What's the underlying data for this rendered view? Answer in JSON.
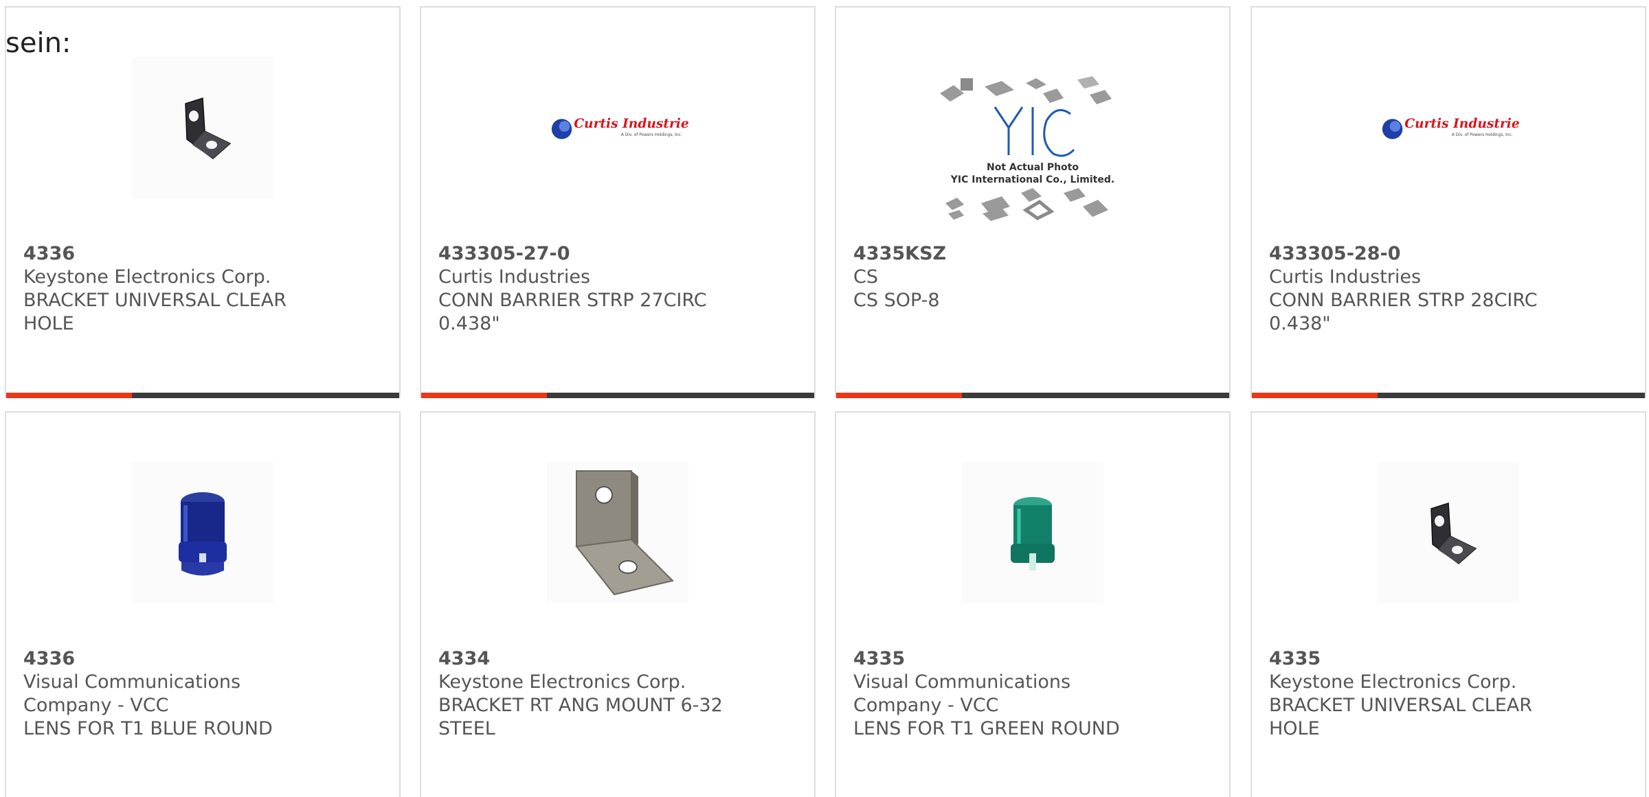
{
  "intro_text": "sein:",
  "colors": {
    "accent": "#e8391a",
    "bar": "#3b3b3b",
    "text": "#555555",
    "border": "#dedede"
  },
  "products": [
    {
      "part_number": "4336",
      "manufacturer": "Keystone Electronics Corp.",
      "description": "BRACKET UNIVERSAL CLEAR HOLE",
      "image": "bracket-small-icon"
    },
    {
      "part_number": "433305-27-0",
      "manufacturer": "Curtis Industries",
      "description": "CONN BARRIER STRP 27CIRC 0.438\"",
      "image": "curtis-industries-logo",
      "logo_text": "Curtis Industries",
      "logo_subtext": "A Div. of Powers Holdings, Inc."
    },
    {
      "part_number": "4335KSZ",
      "manufacturer": "CS",
      "description": "CS SOP-8",
      "image": "yic-placeholder-image",
      "placeholder_line1": "Not Actual Photo",
      "placeholder_line2": "YIC International Co., Limited."
    },
    {
      "part_number": "433305-28-0",
      "manufacturer": "Curtis Industries",
      "description": "CONN BARRIER STRP 28CIRC 0.438\"",
      "image": "curtis-industries-logo",
      "logo_text": "Curtis Industries",
      "logo_subtext": "A Div. of Powers Holdings, Inc."
    },
    {
      "part_number": "4336",
      "manufacturer": "Visual Communications Company - VCC",
      "description": "LENS FOR T1 BLUE ROUND",
      "image": "blue-lens-icon"
    },
    {
      "part_number": "4334",
      "manufacturer": "Keystone Electronics Corp.",
      "description": "BRACKET RT ANG MOUNT 6-32 STEEL",
      "image": "steel-bracket-icon"
    },
    {
      "part_number": "4335",
      "manufacturer": "Visual Communications Company - VCC",
      "description": "LENS FOR T1 GREEN ROUND",
      "image": "green-lens-icon"
    },
    {
      "part_number": "4335",
      "manufacturer": "Keystone Electronics Corp.",
      "description": "BRACKET UNIVERSAL CLEAR HOLE",
      "image": "bracket-small-icon"
    }
  ]
}
